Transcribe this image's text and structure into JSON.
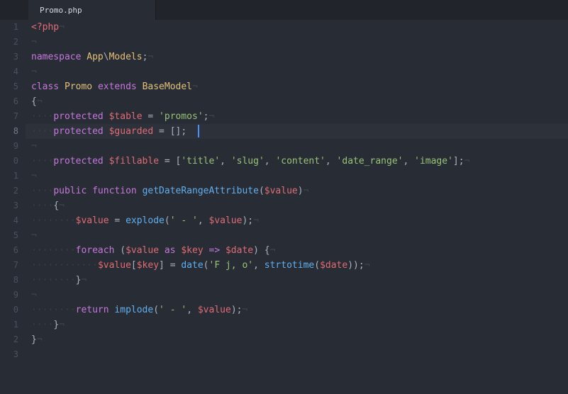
{
  "tab": {
    "filename": "Promo.php"
  },
  "gutter": {
    "lines": [
      "1",
      "2",
      "3",
      "4",
      "5",
      "6",
      "7",
      "8",
      "9",
      "0",
      "1",
      "2",
      "3",
      "4",
      "5",
      "6",
      "7",
      "8",
      "9",
      "0",
      "1",
      "2",
      "3"
    ],
    "current_index": 7
  },
  "code": {
    "php_open": "<?php",
    "namespace_kw": "namespace",
    "namespace_path1": "App",
    "namespace_sep": "\\",
    "namespace_path2": "Models",
    "class_kw": "class",
    "class_name": "Promo",
    "extends_kw": "extends",
    "base_class": "BaseModel",
    "brace_open": "{",
    "brace_close": "}",
    "protected_kw": "protected",
    "table_var": "$table",
    "eq": " = ",
    "table_val": "'promos'",
    "semi": ";",
    "guarded_var": "$guarded",
    "guarded_val": "[]",
    "fillable_var": "$fillable",
    "fillable_open": "[",
    "fillable_items": [
      "'title'",
      "'slug'",
      "'content'",
      "'date_range'",
      "'image'"
    ],
    "fillable_close": "]",
    "comma": ", ",
    "public_kw": "public",
    "function_kw": "function",
    "method_name": "getDateRangeAttribute",
    "paren_open": "(",
    "paren_close": ")",
    "value_var": "$value",
    "explode_fn": "explode",
    "dash_str": "' - '",
    "foreach_kw": "foreach",
    "as_kw": "as",
    "key_var": "$key",
    "arrow_op": "=>",
    "date_var": "$date",
    "bracket_open": "[",
    "bracket_close": "]",
    "date_fn": "date",
    "date_fmt": "'F j, o'",
    "strtotime_fn": "strtotime",
    "return_kw": "return",
    "implode_fn": "implode",
    "inv_char": "¬",
    "dot2": "··",
    "dot4": "····",
    "dot8": "········",
    "dot12": "············"
  }
}
